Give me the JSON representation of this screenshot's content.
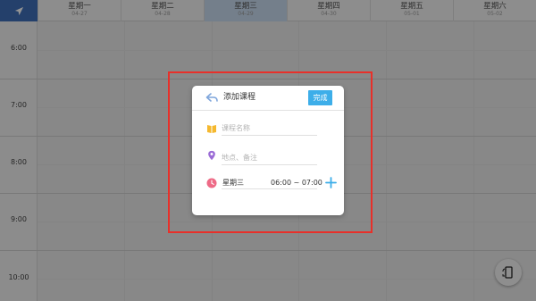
{
  "header": {
    "days": [
      {
        "name": "星期一",
        "date": "04-27",
        "active": false
      },
      {
        "name": "星期二",
        "date": "04-28",
        "active": false
      },
      {
        "name": "星期三",
        "date": "04-29",
        "active": true
      },
      {
        "name": "星期四",
        "date": "04-30",
        "active": false
      },
      {
        "name": "星期五",
        "date": "05-01",
        "active": false
      },
      {
        "name": "星期六",
        "date": "05-02",
        "active": false
      }
    ]
  },
  "times": [
    "6:00",
    "7:00",
    "8:00",
    "9:00",
    "10:00"
  ],
  "dialog": {
    "title": "添加课程",
    "done_label": "完成",
    "course_name_placeholder": "课程名称",
    "location_placeholder": "地点、备注",
    "weekday": "星期三",
    "time_range": "06:00 ~ 07:00"
  },
  "colors": {
    "accent": "#3daee9",
    "header_corner": "#3f6fb8",
    "active_day": "#c8dbef",
    "annotation": "#e8302a",
    "book_icon": "#f5b82e",
    "location_icon": "#9b6cd6",
    "clock_icon": "#ee6a86"
  },
  "icons": {
    "corner": "send-arrow-icon",
    "back": "back-arrow-icon",
    "course": "book-icon",
    "location": "location-pin-icon",
    "time": "clock-icon",
    "add": "plus-icon",
    "fab": "phone-rotate-icon"
  }
}
